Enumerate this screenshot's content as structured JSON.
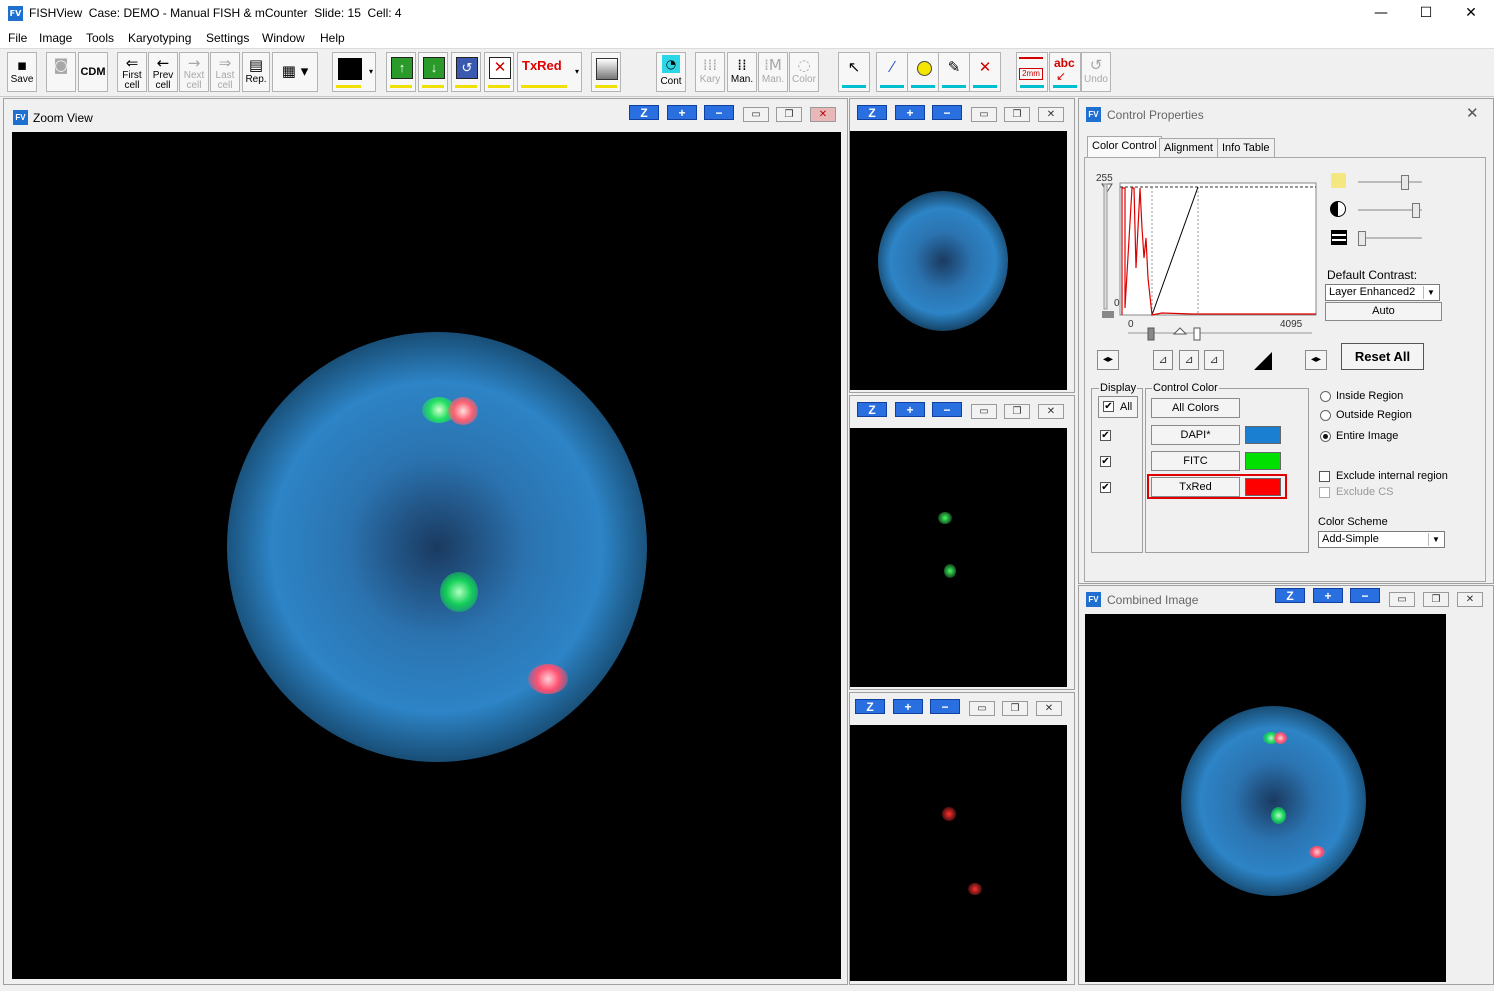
{
  "window": {
    "app_icon": "FV",
    "title": "FISHView  Case: DEMO - Manual FISH & mCounter  Slide: 15  Cell: 4",
    "minimize": "—",
    "maximize": "☐",
    "close": "✕"
  },
  "menu": [
    "File",
    "Image",
    "Tools",
    "Karyotyping",
    "Settings",
    "Window",
    "Help"
  ],
  "toolbar": {
    "save": "Save",
    "cdm": "CDM",
    "first_cell": [
      "First",
      "cell"
    ],
    "prev_cell": [
      "Prev",
      "cell"
    ],
    "next_cell": [
      "Next",
      "cell"
    ],
    "last_cell": [
      "Last",
      "cell"
    ],
    "rep": "Rep.",
    "txred": "TxRed",
    "cont": "Cont",
    "kary": "Kary",
    "man": "Man.",
    "man2": "Man.",
    "color": "Color",
    "scale_label": "2mm",
    "abc_label": "abc",
    "undo": "Undo",
    "colors": {
      "yellow": "#f0e000",
      "cyan": "#00c0d0",
      "red": "#e00000"
    }
  },
  "zoom_view": {
    "title": "Zoom View",
    "z": "Z",
    "plus": "+",
    "minus": "−"
  },
  "small_views": {
    "z": "Z",
    "plus": "+",
    "minus": "−"
  },
  "control_properties": {
    "title": "Control Properties",
    "tabs": [
      "Color Control",
      "Alignment",
      "Info Table"
    ],
    "histogram": {
      "y_max": "255",
      "y_min": "0",
      "x_min": "0",
      "x_max": "4095"
    },
    "default_contrast_label": "Default Contrast:",
    "default_contrast_value": "Layer Enhanced2",
    "auto": "Auto",
    "reset_all": "Reset All",
    "display_label": "Display",
    "all_label": "All",
    "control_color_label": "Control Color",
    "all_colors": "All Colors",
    "channels": [
      {
        "name": "DAPI*",
        "color": "#1a7fd0",
        "checked": true
      },
      {
        "name": "FITC",
        "color": "#00e000",
        "checked": true
      },
      {
        "name": "TxRed",
        "color": "#ff0000",
        "checked": true,
        "selected": true
      }
    ],
    "region_options": [
      {
        "label": "Inside Region",
        "selected": false
      },
      {
        "label": "Outside Region",
        "selected": false
      },
      {
        "label": "Entire Image",
        "selected": true
      }
    ],
    "exclude_internal": "Exclude internal region",
    "exclude_cs": "Exclude CS",
    "color_scheme_label": "Color Scheme",
    "color_scheme_value": "Add-Simple"
  },
  "combined_image": {
    "title": "Combined Image",
    "z": "Z",
    "plus": "+",
    "minus": "−"
  }
}
